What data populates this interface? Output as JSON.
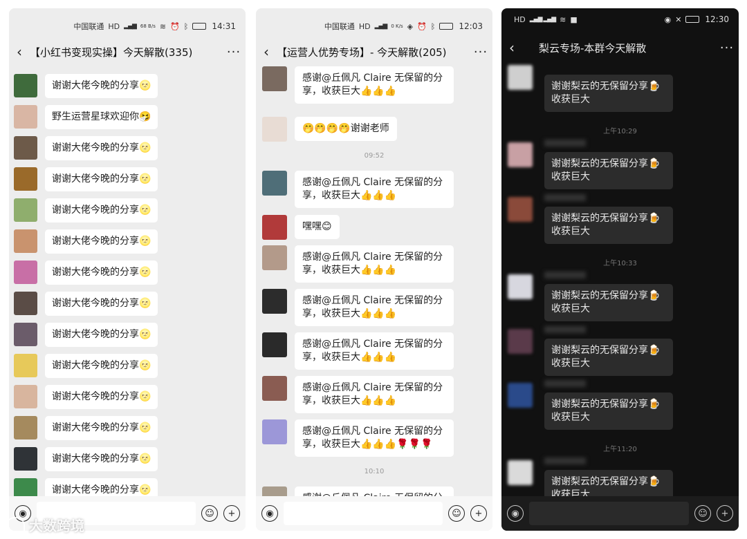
{
  "panel1": {
    "status": {
      "carrier": "中国联通",
      "net": "HD",
      "speed": "68 B/s",
      "time": "14:31"
    },
    "title": "【小红书变现实操】今天解散(335)",
    "more": "···",
    "messages": [
      {
        "text": "谢谢大佬今晚的分享🌝",
        "color": "#3f6b3c"
      },
      {
        "text": "野生运营星球欢迎你🤧",
        "color": "#d9b6a4"
      },
      {
        "text": "谢谢大佬今晚的分享🌝",
        "color": "#6d5a49"
      },
      {
        "text": "谢谢大佬今晚的分享🌝",
        "color": "#9a6a2a"
      },
      {
        "text": "谢谢大佬今晚的分享🌝",
        "color": "#8fae6d"
      },
      {
        "text": "谢谢大佬今晚的分享🌝",
        "color": "#c9936e"
      },
      {
        "text": "谢谢大佬今晚的分享🌝",
        "color": "#c86fa6"
      },
      {
        "text": "谢谢大佬今晚的分享🌝",
        "color": "#5a4c46"
      },
      {
        "text": "谢谢大佬今晚的分享🌝",
        "color": "#6b5c6a"
      },
      {
        "text": "谢谢大佬今晚的分享🌝",
        "color": "#e7c95a"
      },
      {
        "text": "谢谢大佬今晚的分享🌝",
        "color": "#d8b59e"
      },
      {
        "text": "谢谢大佬今晚的分享🌝",
        "color": "#a58a5e"
      },
      {
        "text": "谢谢大佬今晚的分享🌝",
        "color": "#2f3337"
      },
      {
        "text": "谢谢大佬今晚的分享🌝",
        "color": "#3d8a4b"
      }
    ]
  },
  "panel2": {
    "status": {
      "carrier": "中国联通",
      "net": "HD",
      "speed": "0 K/s",
      "time": "12:03"
    },
    "title": "【运营人优势专场】- 今天解散(205)",
    "more": "···",
    "messages": [
      {
        "text": "感谢@丘佩凡 Claire 无保留的分享，收获巨大👍👍👍",
        "color": "#7a6a60"
      },
      {
        "text": "🤭🤭🤭🤭谢谢老师",
        "color": "#e8dcd4"
      },
      {
        "text": "感谢@丘佩凡 Claire 无保留的分享，收获巨大👍👍👍",
        "color": "#4f6e78"
      },
      {
        "text": "嘿嘿😊",
        "color": "#b13a3a"
      },
      {
        "text": "感谢@丘佩凡 Claire 无保留的分享，收获巨大👍👍👍",
        "color": "#b39a8a"
      },
      {
        "text": "感谢@丘佩凡 Claire 无保留的分享，收获巨大👍👍👍",
        "color": "#2c2c2c"
      },
      {
        "text": "感谢@丘佩凡 Claire 无保留的分享，收获巨大👍👍👍",
        "color": "#2a2a2a"
      },
      {
        "text": "感谢@丘佩凡 Claire 无保留的分享，收获巨大👍👍👍",
        "color": "#8a5c52"
      },
      {
        "text": "感谢@丘佩凡 Claire 无保留的分享，收获巨大👍👍👍🌹🌹🌹",
        "color": "#9c97d8"
      },
      {
        "text": "感谢@丘佩凡 Claire 无保留的分",
        "color": "#a89c8c"
      }
    ],
    "timestamps": [
      "09:52",
      "10:10"
    ]
  },
  "panel3": {
    "status": {
      "net": "HD",
      "battery": "",
      "time": "12:30"
    },
    "title": "梨云专场-本群今天解散",
    "more": "···",
    "messages": [
      {
        "text": "谢谢梨云的无保留分享🍺收获巨大",
        "color": "#cfcfcf"
      },
      {
        "text": "谢谢梨云的无保留分享🍺收获巨大",
        "color": "#c8a0a4"
      },
      {
        "text": "谢谢梨云的无保留分享🍺收获巨大",
        "color": "#8a4a3a"
      },
      {
        "text": "谢谢梨云的无保留分享🍺收获巨大",
        "color": "#d7d7df"
      },
      {
        "text": "谢谢梨云的无保留分享🍺收获巨大",
        "color": "#5a3a4a"
      },
      {
        "text": "谢谢梨云的无保留分享🍺收获巨大",
        "color": "#2a4a8a"
      },
      {
        "text": "谢谢梨云的无保留分享🍺收获巨大",
        "color": "#dadada"
      }
    ],
    "timestamps": [
      "上午10:29",
      "上午10:33",
      "上午11:20"
    ]
  },
  "watermark": "大数跨境",
  "icons": {
    "back": "‹",
    "voice": "◉",
    "emoji": "☺",
    "plus": "+"
  }
}
